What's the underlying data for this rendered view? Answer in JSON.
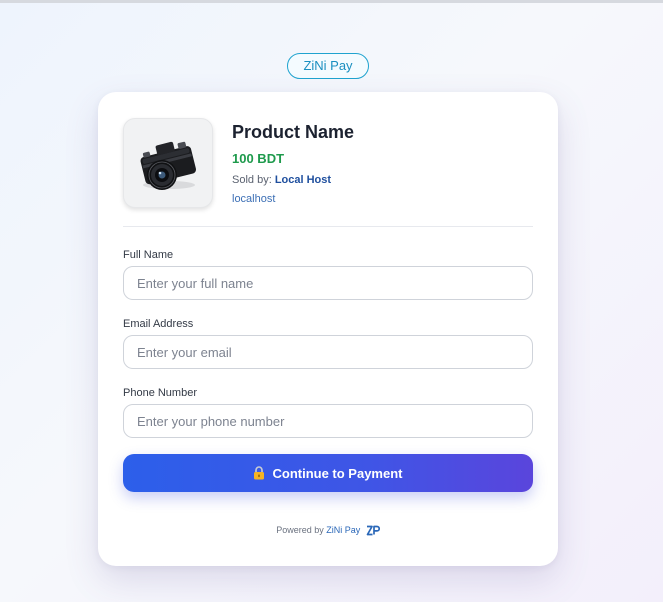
{
  "brand_pill": "ZiNi Pay",
  "product": {
    "name": "Product Name",
    "price": "100 BDT",
    "sold_by_label": "Sold by:",
    "seller_name": "Local Host",
    "site": "localhost",
    "image_icon": "camera-product-image"
  },
  "form": {
    "full_name": {
      "label": "Full Name",
      "placeholder": "Enter your full name",
      "value": ""
    },
    "email": {
      "label": "Email Address",
      "placeholder": "Enter your email",
      "value": ""
    },
    "phone": {
      "label": "Phone Number",
      "placeholder": "Enter your phone number",
      "value": ""
    }
  },
  "submit": {
    "label": "Continue to Payment",
    "icon": "lock-icon"
  },
  "footer": {
    "powered_text": "Powered by",
    "brand": "ZiNi Pay",
    "logo_icon": "zp-logo-icon"
  },
  "colors": {
    "accent": "#2c5fea",
    "accent_end": "#5a45dc",
    "price_green": "#1e9a4c",
    "brand_cyan": "#1fa3cf",
    "link_blue": "#1f4f9e"
  }
}
